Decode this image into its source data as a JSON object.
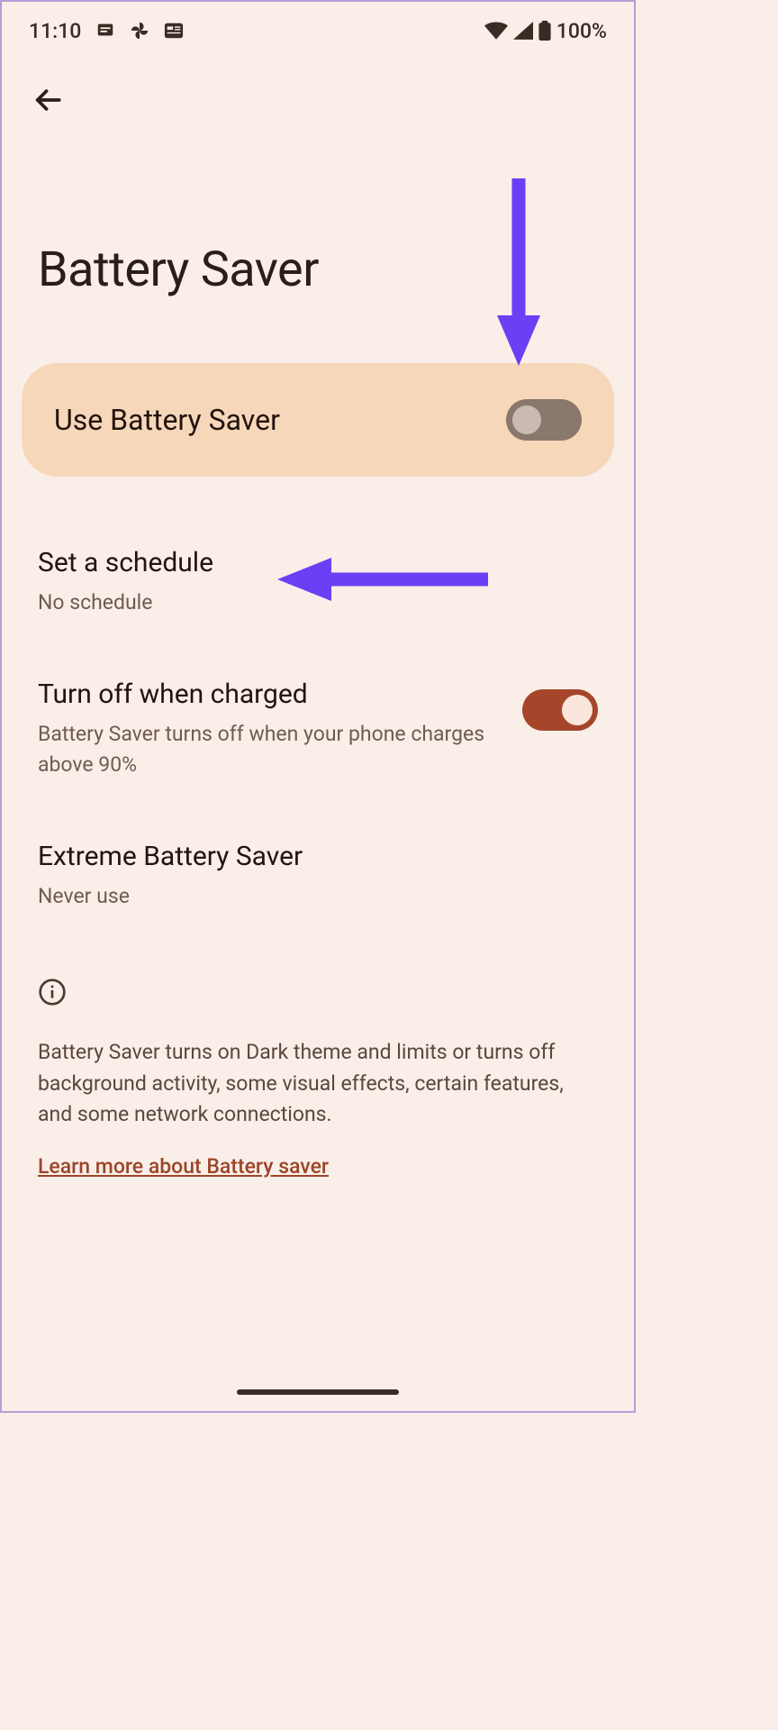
{
  "statusbar": {
    "time": "11:10",
    "battery_pct": "100%"
  },
  "page": {
    "title": "Battery Saver"
  },
  "main_toggle": {
    "label": "Use Battery Saver",
    "on": false
  },
  "schedule": {
    "title": "Set a schedule",
    "subtitle": "No schedule"
  },
  "charged": {
    "title": "Turn off when charged",
    "subtitle": "Battery Saver turns off when your phone charges above 90%",
    "on": true
  },
  "extreme": {
    "title": "Extreme Battery Saver",
    "subtitle": "Never use"
  },
  "info": {
    "text": "Battery Saver turns on Dark theme and limits or turns off background activity, some visual effects, certain features, and some network connections.",
    "learn_more": "Learn more about Battery saver"
  },
  "colors": {
    "accent": "#a5462a",
    "annotation": "#6a3ff5"
  }
}
